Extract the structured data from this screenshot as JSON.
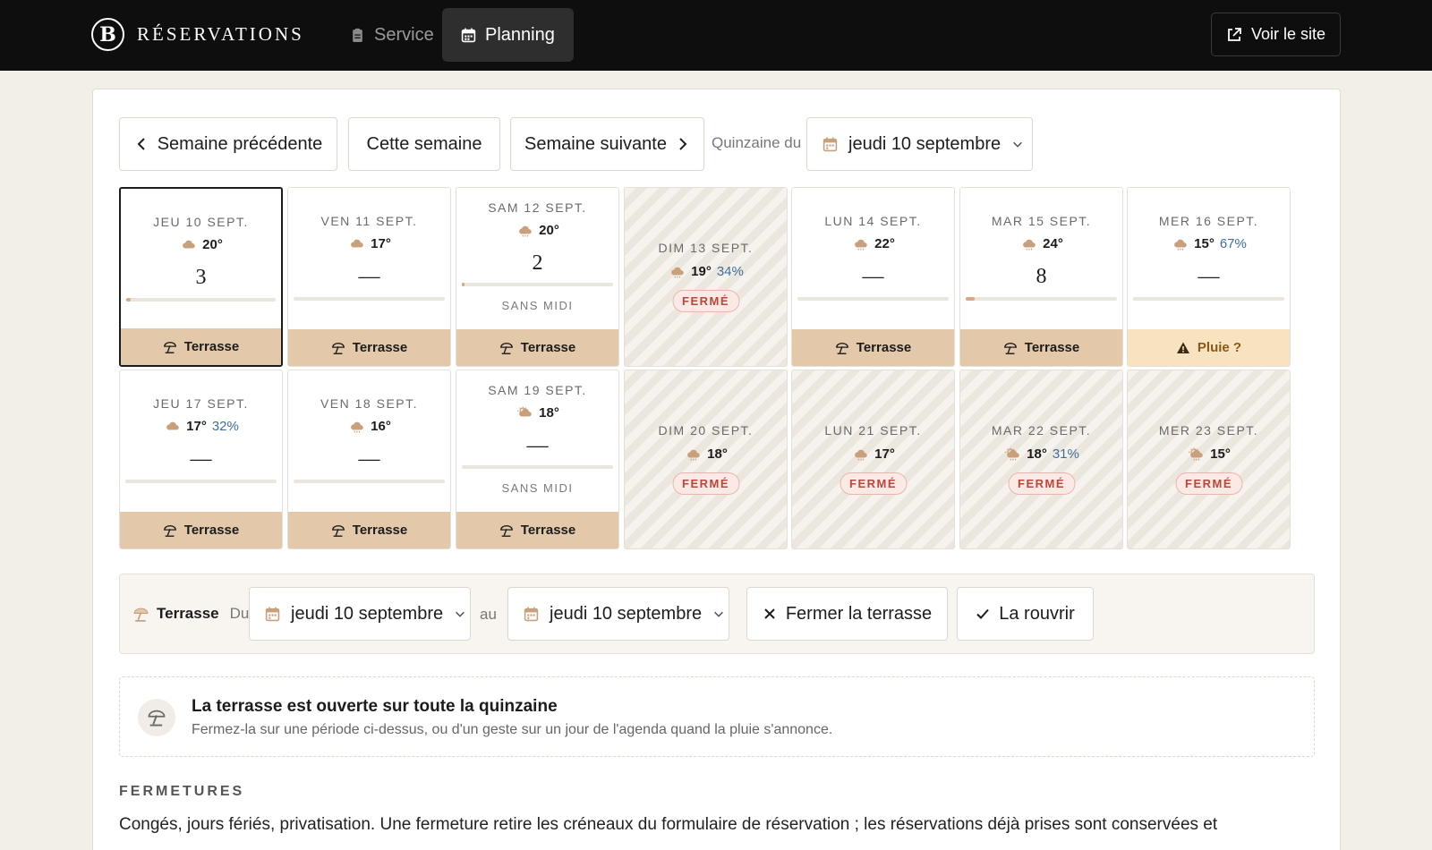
{
  "header": {
    "brand_letter": "B",
    "brand_name": "RÉSERVATIONS",
    "tabs": [
      {
        "label": "Service",
        "active": false
      },
      {
        "label": "Planning",
        "active": true
      }
    ],
    "view_site_label": "Voir le site"
  },
  "toolbar": {
    "prev_week": "Semaine précédente",
    "this_week": "Cette semaine",
    "next_week": "Semaine suivante",
    "fortnight_label": "Quinzaine du",
    "fortnight_value": "jeudi 10 septembre"
  },
  "days": [
    {
      "label": "JEU 10 SEPT.",
      "temp": "20°",
      "rain": "",
      "weather_icon": "cloud-icon",
      "count": "3",
      "fill": 0.03,
      "note": "",
      "closed": false,
      "selected": true,
      "foot": "Terrasse",
      "foot_type": "terrace"
    },
    {
      "label": "VEN 11 SEPT.",
      "temp": "17°",
      "rain": "",
      "weather_icon": "cloud-icon",
      "count": "—",
      "fill": 0,
      "note": "",
      "closed": false,
      "selected": false,
      "foot": "Terrasse",
      "foot_type": "terrace"
    },
    {
      "label": "SAM 12 SEPT.",
      "temp": "20°",
      "rain": "",
      "weather_icon": "cloud-rain-icon",
      "count": "2",
      "fill": 0.02,
      "note": "SANS MIDI",
      "closed": false,
      "selected": false,
      "foot": "Terrasse",
      "foot_type": "terrace"
    },
    {
      "label": "DIM 13 SEPT.",
      "temp": "19°",
      "rain": "34%",
      "weather_icon": "cloud-rain-icon",
      "count": "",
      "fill": 0,
      "note": "",
      "closed": true,
      "closed_label": "FERMÉ",
      "selected": false,
      "foot": "",
      "foot_type": "none"
    },
    {
      "label": "LUN 14 SEPT.",
      "temp": "22°",
      "rain": "",
      "weather_icon": "cloud-rain-icon",
      "count": "—",
      "fill": 0,
      "note": "",
      "closed": false,
      "selected": false,
      "foot": "Terrasse",
      "foot_type": "terrace"
    },
    {
      "label": "MAR 15 SEPT.",
      "temp": "24°",
      "rain": "",
      "weather_icon": "cloud-rain-icon",
      "count": "8",
      "fill": 0.06,
      "note": "",
      "closed": false,
      "selected": false,
      "foot": "Terrasse",
      "foot_type": "terrace"
    },
    {
      "label": "MER 16 SEPT.",
      "temp": "15°",
      "rain": "67%",
      "weather_icon": "cloud-rain-icon",
      "count": "—",
      "fill": 0,
      "note": "",
      "closed": false,
      "selected": false,
      "foot": "Pluie ?",
      "foot_type": "warn"
    },
    {
      "label": "JEU 17 SEPT.",
      "temp": "17°",
      "rain": "32%",
      "weather_icon": "cloud-icon",
      "count": "—",
      "fill": 0,
      "note": "",
      "closed": false,
      "selected": false,
      "foot": "Terrasse",
      "foot_type": "terrace"
    },
    {
      "label": "VEN 18 SEPT.",
      "temp": "16°",
      "rain": "",
      "weather_icon": "cloud-rain-icon",
      "count": "—",
      "fill": 0,
      "note": "",
      "closed": false,
      "selected": false,
      "foot": "Terrasse",
      "foot_type": "terrace"
    },
    {
      "label": "SAM 19 SEPT.",
      "temp": "18°",
      "rain": "",
      "weather_icon": "sun-cloud-icon",
      "count": "—",
      "fill": 0,
      "note": "SANS MIDI",
      "closed": false,
      "selected": false,
      "foot": "Terrasse",
      "foot_type": "terrace"
    },
    {
      "label": "DIM 20 SEPT.",
      "temp": "18°",
      "rain": "",
      "weather_icon": "cloud-rain-icon",
      "count": "",
      "fill": 0,
      "note": "",
      "closed": true,
      "closed_label": "FERMÉ",
      "selected": false,
      "foot": "",
      "foot_type": "none"
    },
    {
      "label": "LUN 21 SEPT.",
      "temp": "17°",
      "rain": "",
      "weather_icon": "cloud-rain-icon",
      "count": "",
      "fill": 0,
      "note": "",
      "closed": true,
      "closed_label": "FERMÉ",
      "selected": false,
      "foot": "",
      "foot_type": "none"
    },
    {
      "label": "MAR 22 SEPT.",
      "temp": "18°",
      "rain": "31%",
      "weather_icon": "sun-cloud-rain-icon",
      "count": "",
      "fill": 0,
      "note": "",
      "closed": true,
      "closed_label": "FERMÉ",
      "selected": false,
      "foot": "",
      "foot_type": "none"
    },
    {
      "label": "MER 23 SEPT.",
      "temp": "15°",
      "rain": "",
      "weather_icon": "sun-cloud-rain-icon",
      "count": "",
      "fill": 0,
      "note": "",
      "closed": true,
      "closed_label": "FERMÉ",
      "selected": false,
      "foot": "",
      "foot_type": "none"
    }
  ],
  "terrace": {
    "label": "Terrasse",
    "from_label": "Du",
    "from_value": "jeudi 10 septembre",
    "to_label": "au",
    "to_value": "jeudi 10 septembre",
    "close_label": "Fermer la terrasse",
    "reopen_label": "La rouvrir"
  },
  "notice": {
    "title": "La terrasse est ouverte sur toute la quinzaine",
    "subtitle": "Fermez-la sur une période ci-dessus, ou d'un geste sur un jour de l'agenda quand la pluie s'annonce."
  },
  "closures": {
    "title": "FERMETURES",
    "text": "Congés, jours fériés, privatisation. Une fermeture retire les créneaux du formulaire de réservation ; les réservations déjà prises sont conservées et"
  },
  "colors": {
    "terrace": "#e3c9aa",
    "warn": "#f8e3c0",
    "closed_text": "#b9473a",
    "rain_text": "#3d6e9c",
    "bar_fill": "#d8a78a"
  }
}
